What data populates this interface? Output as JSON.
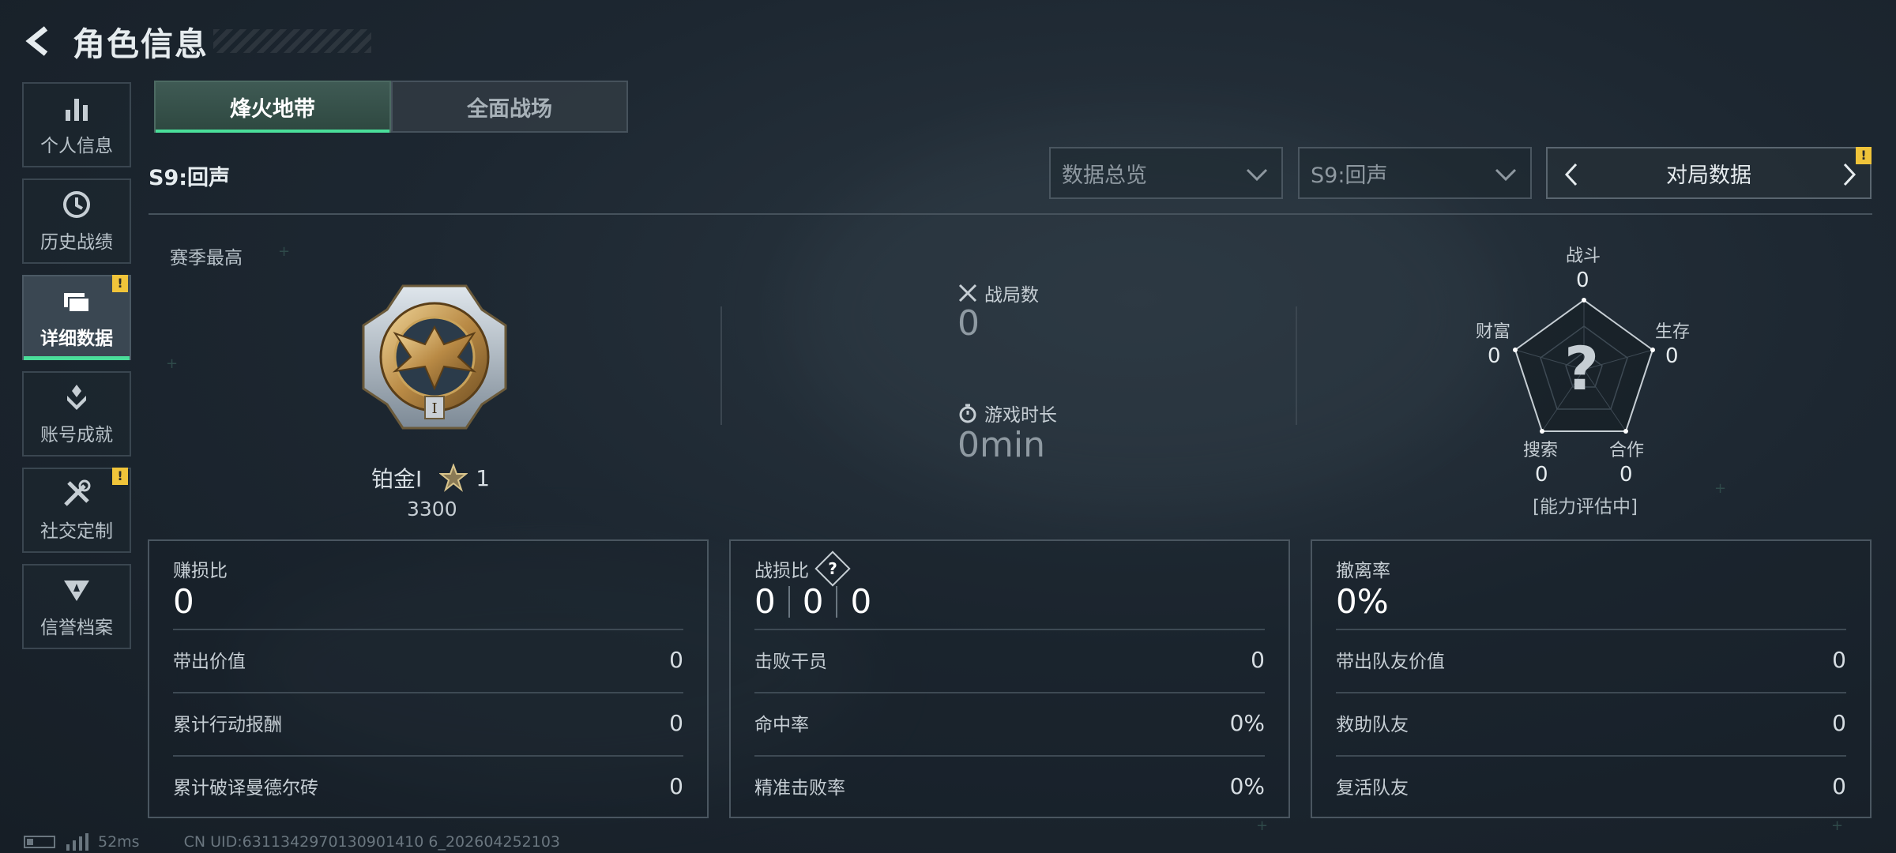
{
  "header": {
    "title": "角色信息"
  },
  "sidebar": {
    "items": [
      {
        "label": "个人信息",
        "icon": "bar-chart-icon",
        "badge": ""
      },
      {
        "label": "历史战绩",
        "icon": "clock-icon",
        "badge": ""
      },
      {
        "label": "详细数据",
        "icon": "folder-icon",
        "badge": "!"
      },
      {
        "label": "账号成就",
        "icon": "achievement-icon",
        "badge": ""
      },
      {
        "label": "社交定制",
        "icon": "tools-icon",
        "badge": "!"
      },
      {
        "label": "信誉档案",
        "icon": "shield-icon",
        "badge": ""
      }
    ],
    "active_index": 2
  },
  "mode_tabs": [
    {
      "label": "烽火地带"
    },
    {
      "label": "全面战场"
    }
  ],
  "season": {
    "label": "S9:回声"
  },
  "filters": {
    "overview_dropdown": "数据总览",
    "season_dropdown": "S9:回声",
    "match_data": "对局数据",
    "match_badge": "!"
  },
  "rank": {
    "season_best_label": "赛季最高",
    "tier": "铂金I",
    "stars": "1",
    "score": "3300"
  },
  "stats": {
    "matches_label": "战局数",
    "matches_value": "0",
    "playtime_label": "游戏时长",
    "playtime_value": "0min"
  },
  "radar": {
    "axes": [
      {
        "label": "战斗",
        "value": "0"
      },
      {
        "label": "生存",
        "value": "0"
      },
      {
        "label": "合作",
        "value": "0"
      },
      {
        "label": "搜索",
        "value": "0"
      },
      {
        "label": "财富",
        "value": "0"
      }
    ],
    "center_mark": "?",
    "status": "[能力评估中]"
  },
  "cards": {
    "profit": {
      "title": "赚损比",
      "value": "0",
      "rows": [
        {
          "label": "带出价值",
          "value": "0"
        },
        {
          "label": "累计行动报酬",
          "value": "0"
        },
        {
          "label": "累计破译曼德尔砖",
          "value": "0"
        }
      ]
    },
    "kd": {
      "title": "战损比",
      "help": "?",
      "values": [
        "0",
        "0",
        "0"
      ],
      "rows": [
        {
          "label": "击败干员",
          "value": "0"
        },
        {
          "label": "命中率",
          "value": "0%"
        },
        {
          "label": "精准击败率",
          "value": "0%"
        }
      ]
    },
    "extract": {
      "title": "撤离率",
      "value": "0%",
      "rows": [
        {
          "label": "带出队友价值",
          "value": "0"
        },
        {
          "label": "救助队友",
          "value": "0"
        },
        {
          "label": "复活队友",
          "value": "0"
        }
      ]
    }
  },
  "footer": {
    "ping": "52ms",
    "uid": "CN UID:6311342970130901410 6_202604252103"
  },
  "colors": {
    "accent": "#4ade9a",
    "badge": "#f0c43a",
    "bg": "#1d2731"
  }
}
